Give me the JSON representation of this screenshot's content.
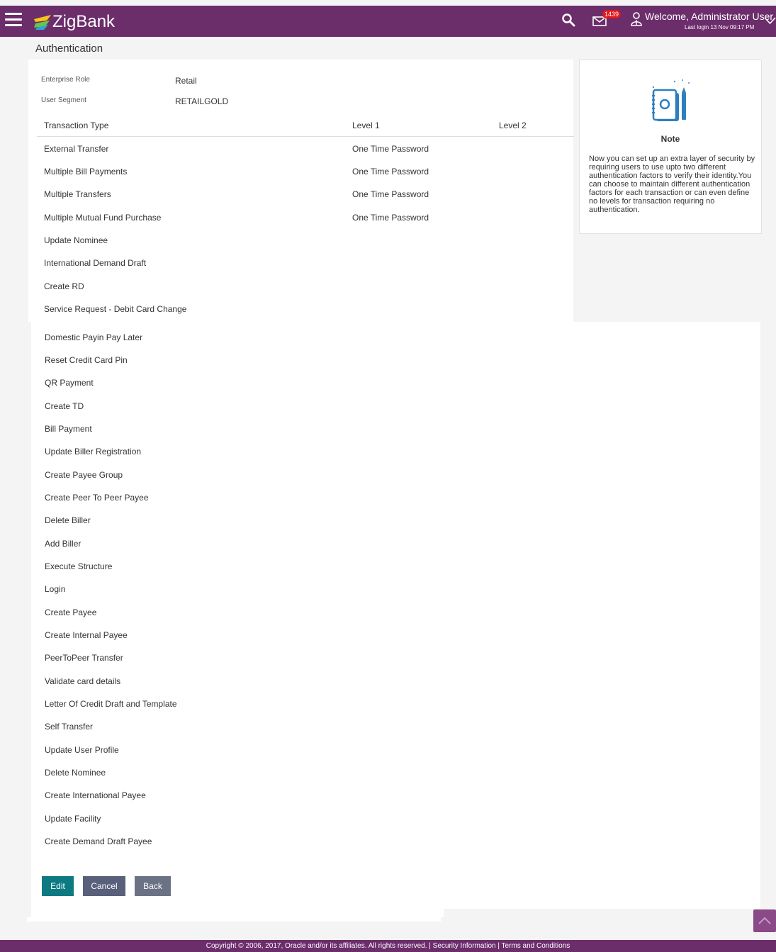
{
  "header": {
    "brand": "ZigBank",
    "mail_count": "1439",
    "welcome": "Welcome, Administrator User",
    "last_login": "Last login 13 Nov 09:17 PM",
    "colors": {
      "bar": "#6c2d6b",
      "badge": "#e0181b"
    }
  },
  "page_title": "Authentication",
  "info": {
    "enterprise_role_label": "Enterprise Role",
    "enterprise_role_value": "Retail",
    "user_segment_label": "User Segment",
    "user_segment_value": "RETAILGOLD"
  },
  "table": {
    "columns": [
      "Transaction Type",
      "Level 1",
      "Level 2"
    ],
    "rows": [
      {
        "name": "External Transfer",
        "level1": "One Time Password"
      },
      {
        "name": "Multiple Bill Payments",
        "level1": "One Time Password"
      },
      {
        "name": "Multiple Transfers",
        "level1": "One Time Password"
      },
      {
        "name": "Multiple Mutual Fund Purchase",
        "level1": "One Time Password"
      },
      {
        "name": "Update Nominee"
      },
      {
        "name": "International Demand Draft"
      },
      {
        "name": "Create RD"
      },
      {
        "name": "Service Request - Debit Card Change"
      },
      {
        "name": "Domestic Payin Pay Later"
      },
      {
        "name": "Reset Credit Card Pin"
      },
      {
        "name": "QR Payment"
      },
      {
        "name": "Create TD"
      },
      {
        "name": "Bill Payment"
      },
      {
        "name": "Update Biller Registration"
      },
      {
        "name": "Create Payee Group"
      },
      {
        "name": "Create Peer To Peer Payee"
      },
      {
        "name": "Delete Biller"
      },
      {
        "name": "Add Biller"
      },
      {
        "name": "Execute Structure"
      },
      {
        "name": "Login"
      },
      {
        "name": "Create Payee"
      },
      {
        "name": "Create Internal Payee"
      },
      {
        "name": "PeerToPeer Transfer"
      },
      {
        "name": "Validate card details"
      },
      {
        "name": "Letter Of Credit Draft and Template"
      },
      {
        "name": "Self Transfer"
      },
      {
        "name": "Update User Profile"
      },
      {
        "name": "Delete Nominee"
      },
      {
        "name": "Create International Payee"
      },
      {
        "name": "Update Facility"
      },
      {
        "name": "Create Demand Draft Payee"
      }
    ]
  },
  "note": {
    "title": "Note",
    "text": "Now you can set up an extra layer of security by requiring users to use upto two different authentication factors to verify their identity.You can choose to maintain different authentication factors for each transaction or can even define no levels for transaction requiring no authentication."
  },
  "buttons": {
    "edit": "Edit",
    "cancel": "Cancel",
    "back": "Back",
    "colors": {
      "edit": "#0d7a82",
      "cancel": "#58607a",
      "back": "#6c7285"
    }
  },
  "footer": {
    "copyright": "Copyright © 2006, 2017, Oracle and/or its affiliates. All rights reserved. | Security Information | Terms and Conditions"
  }
}
